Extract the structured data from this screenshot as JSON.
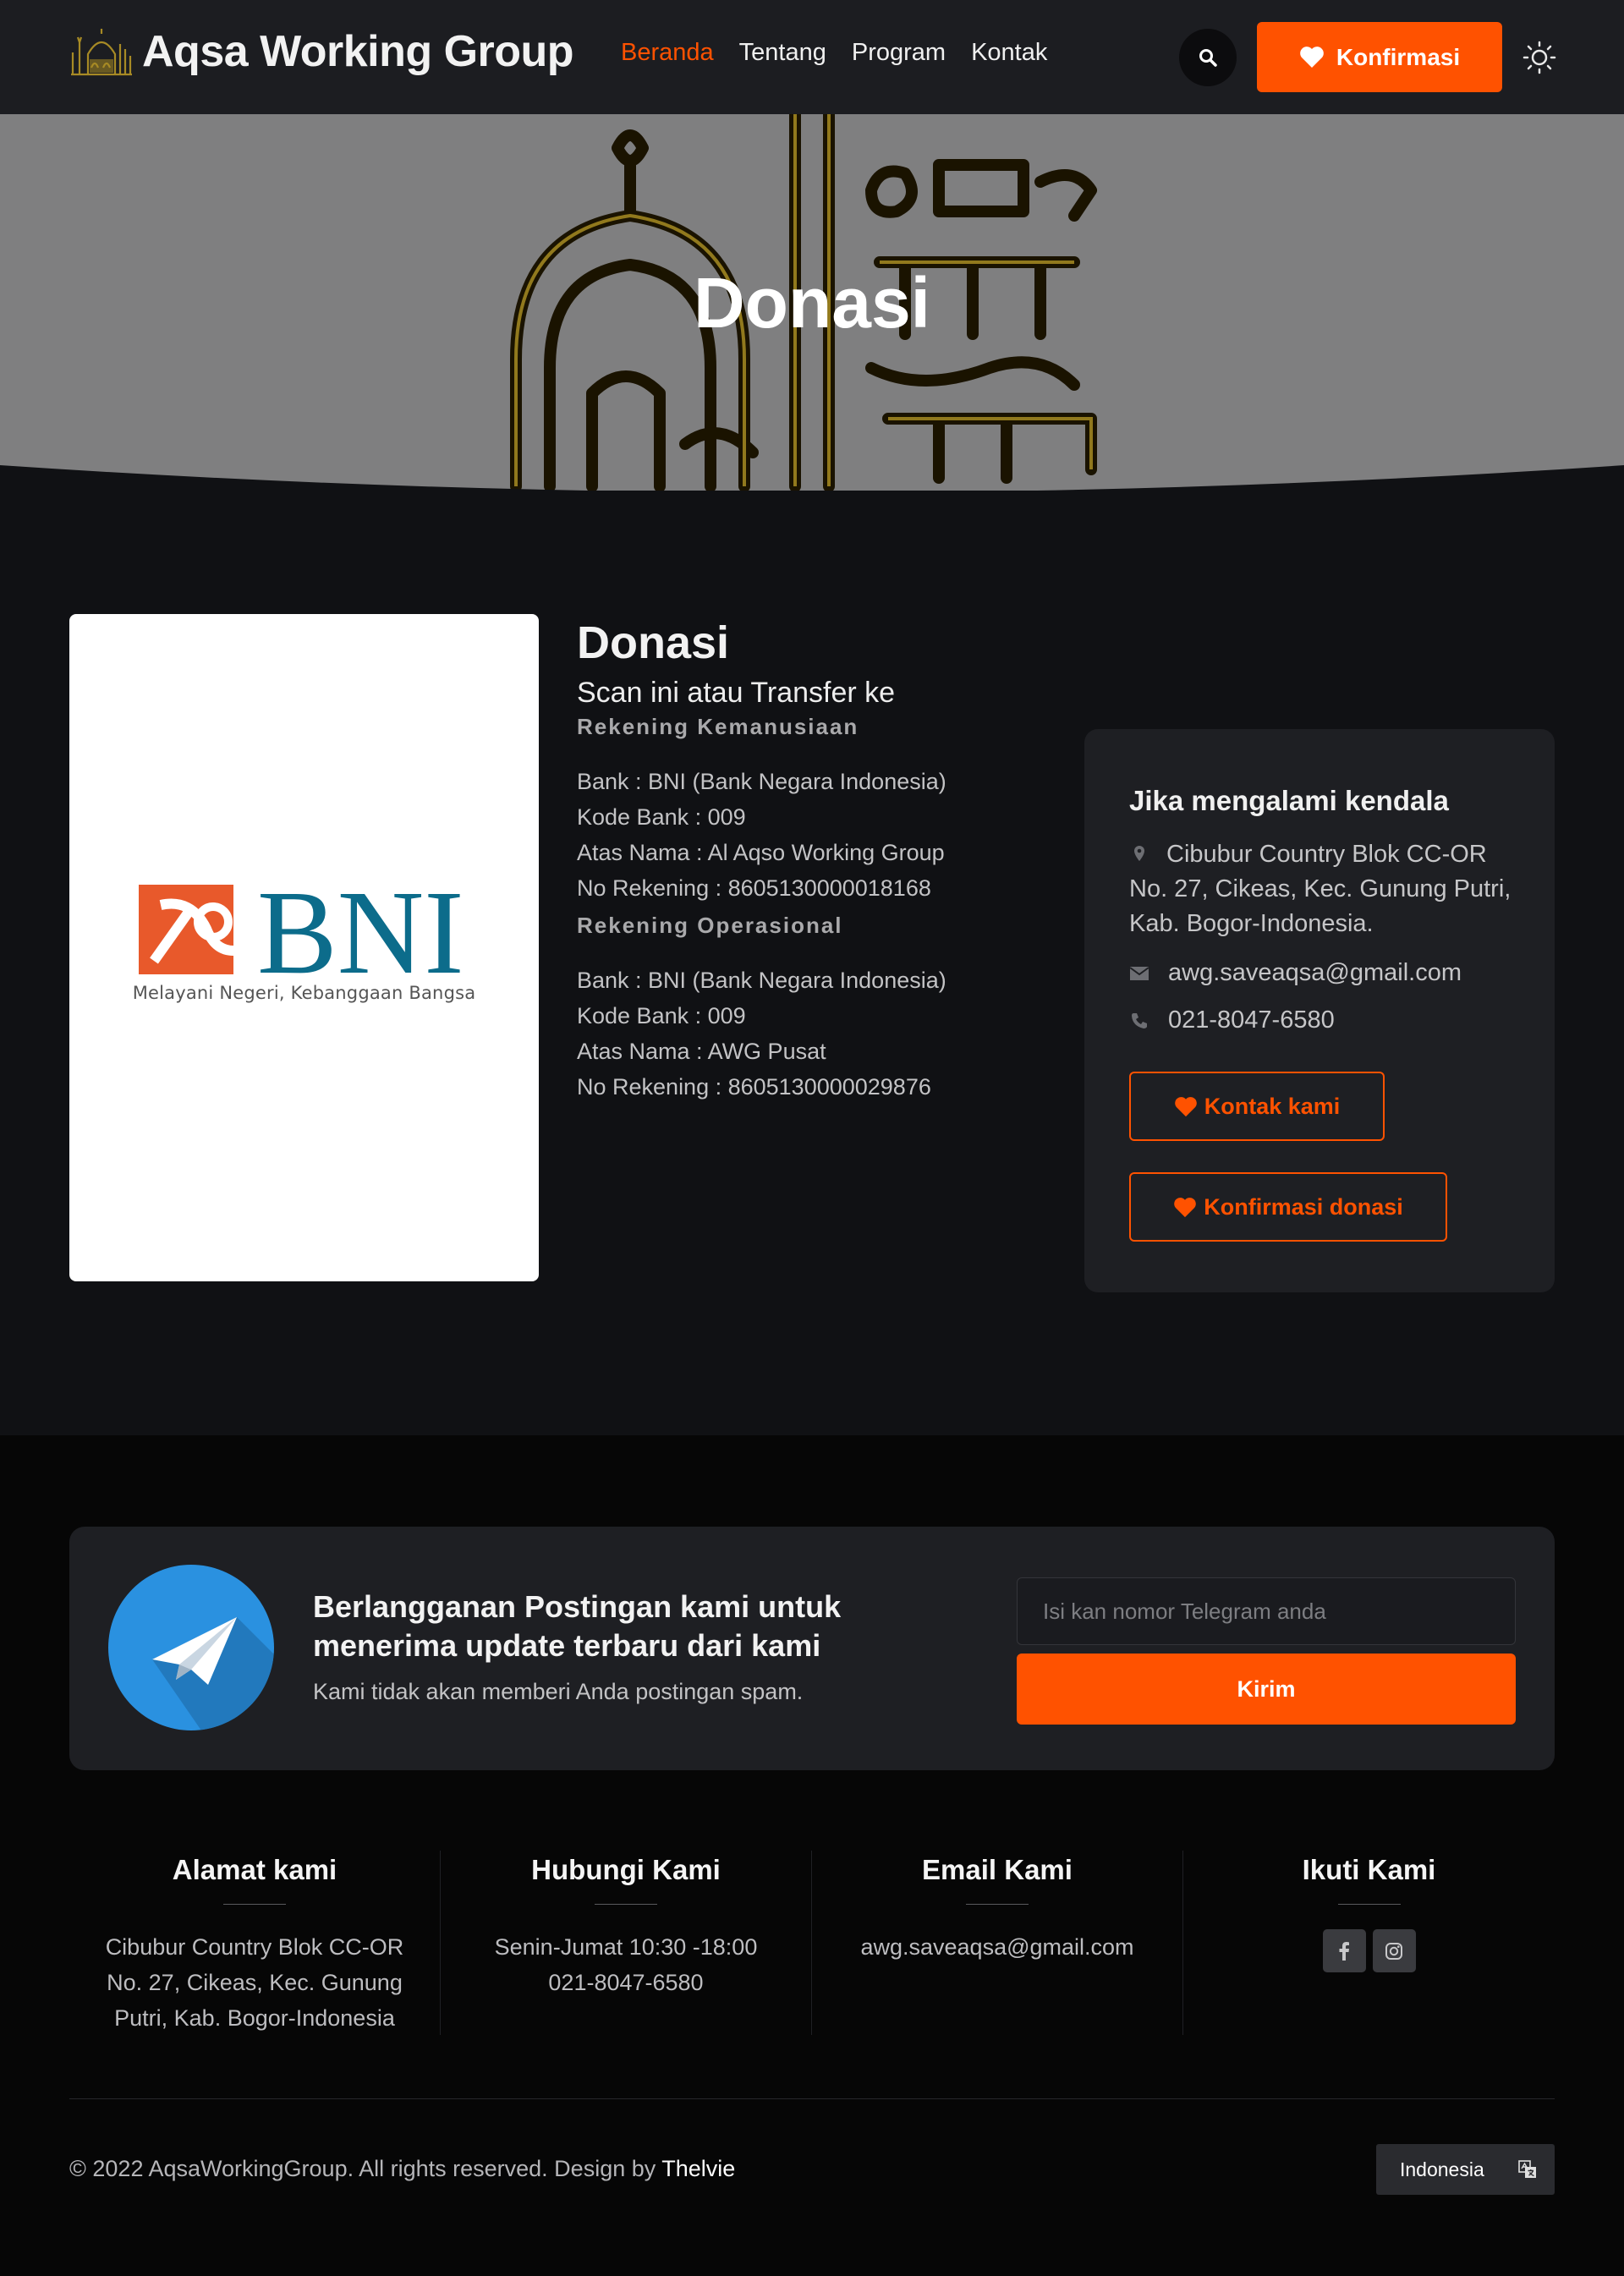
{
  "colors": {
    "accent": "#ff5200",
    "navbar": "#1c1d21",
    "card": "#1e1f23",
    "telegram": "#2a91e0",
    "bni_orange": "#e8592b",
    "bni_teal": "#0c6c8b"
  },
  "nav": {
    "brand": "Aqsa Working Group",
    "links": [
      {
        "label": "Beranda",
        "active": true
      },
      {
        "label": "Tentang",
        "active": false
      },
      {
        "label": "Program",
        "active": false
      },
      {
        "label": "Kontak",
        "active": false
      }
    ],
    "search_icon": "search-icon",
    "confirm_label": "Konfirmasi",
    "theme_icon": "sun-icon"
  },
  "hero": {
    "title": "Donasi"
  },
  "bank_card": {
    "logo_text": "BNI",
    "tagline": "Melayani Negeri, Kebanggaan Bangsa"
  },
  "donation": {
    "title": "Donasi",
    "subtitle": "Scan ini atau Transfer ke",
    "accounts": [
      {
        "heading": "Rekening Kemanusiaan",
        "lines": [
          "Bank : BNI (Bank Negara Indonesia)",
          "Kode Bank : 009",
          "Atas Nama : Al Aqso Working Group",
          "No Rekening : 8605130000018168"
        ]
      },
      {
        "heading": "Rekening Operasional",
        "lines": [
          "Bank : BNI (Bank Negara Indonesia)",
          "Kode Bank : 009",
          "Atas Nama : AWG Pusat",
          "No Rekening : 8605130000029876"
        ]
      }
    ]
  },
  "help": {
    "title": "Jika mengalami kendala",
    "address": "Cibubur Country Blok CC-OR No. 27, Cikeas, Kec. Gunung Putri, Kab. Bogor-Indonesia.",
    "email": "awg.saveaqsa@gmail.com",
    "phone": "021-8047-6580",
    "contact_button": "Kontak kami",
    "confirm_button": "Konfirmasi donasi"
  },
  "subscribe": {
    "title": "Berlangganan Postingan kami untuk menerima update terbaru dari kami",
    "note": "Kami tidak akan memberi Anda postingan spam.",
    "placeholder": "Isi kan nomor Telegram anda",
    "button": "Kirim"
  },
  "footer": {
    "columns": [
      {
        "title": "Alamat kami",
        "lines": [
          "Cibubur Country Blok CC-OR",
          "No. 27, Cikeas, Kec. Gunung",
          "Putri, Kab. Bogor-Indonesia"
        ]
      },
      {
        "title": "Hubungi Kami",
        "lines": [
          "Senin-Jumat 10:30 -18:00",
          "021-8047-6580"
        ]
      },
      {
        "title": "Email Kami",
        "lines": [
          "awg.saveaqsa@gmail.com"
        ]
      },
      {
        "title": "Ikuti Kami",
        "social": [
          "facebook-icon",
          "instagram-icon"
        ]
      }
    ],
    "copyright": "© 2022 AqsaWorkingGroup. All rights reserved. Design by",
    "credit": "Thelvie",
    "language": "Indonesia"
  }
}
